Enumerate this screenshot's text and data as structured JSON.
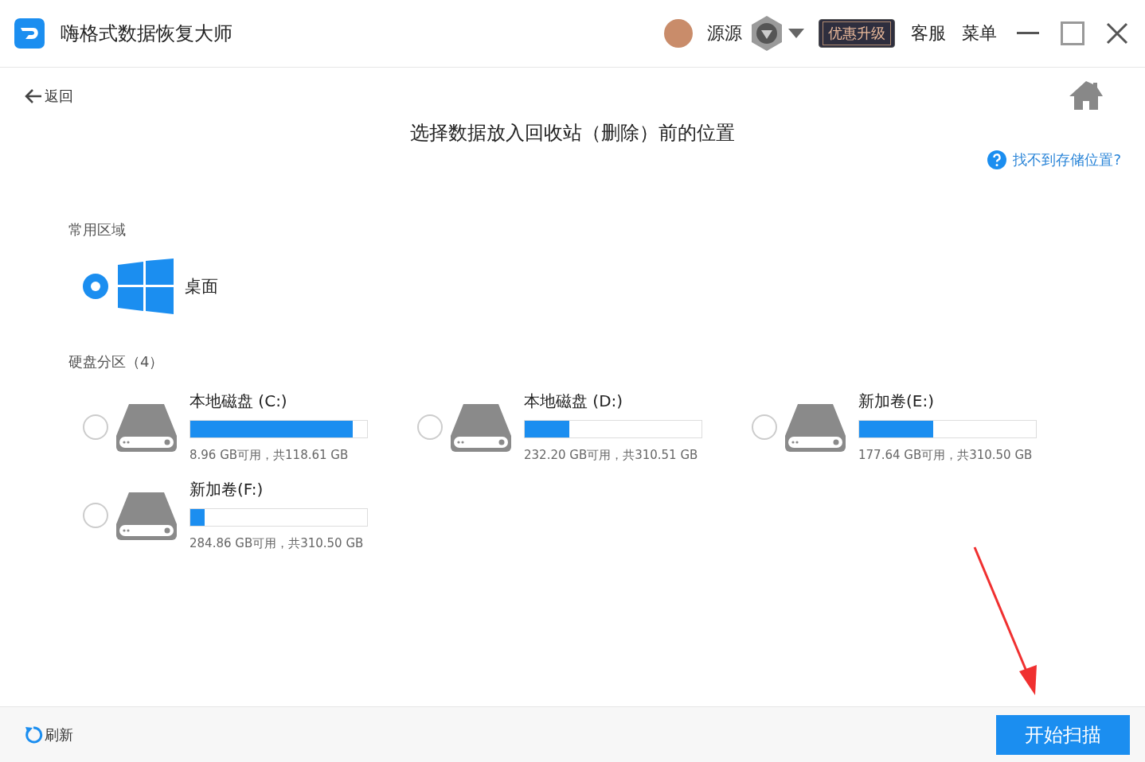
{
  "app": {
    "title": "嗨格式数据恢复大师"
  },
  "header": {
    "user_name": "源源",
    "upgrade_label": "优惠升级",
    "service_label": "客服",
    "menu_label": "菜单"
  },
  "nav": {
    "back_label": "返回"
  },
  "page": {
    "title": "选择数据放入回收站（删除）前的位置",
    "help_link": "找不到存储位置?"
  },
  "common_area": {
    "heading": "常用区域",
    "items": [
      {
        "label": "桌面",
        "selected": true
      }
    ]
  },
  "partitions": {
    "heading": "硬盘分区（4）",
    "drives": [
      {
        "name": "本地磁盘 (C:)",
        "level": 0.92,
        "usage": "8.96 GB可用，共118.61 GB",
        "selected": false
      },
      {
        "name": "本地磁盘 (D:)",
        "level": 0.25,
        "usage": "232.20 GB可用，共310.51 GB",
        "selected": false
      },
      {
        "name": "新加卷(E:)",
        "level": 0.42,
        "usage": "177.64 GB可用，共310.50 GB",
        "selected": false
      },
      {
        "name": "新加卷(F:)",
        "level": 0.08,
        "usage": "284.86 GB可用，共310.50 GB",
        "selected": false
      }
    ]
  },
  "footer": {
    "refresh_label": "刷新",
    "scan_button": "开始扫描"
  }
}
